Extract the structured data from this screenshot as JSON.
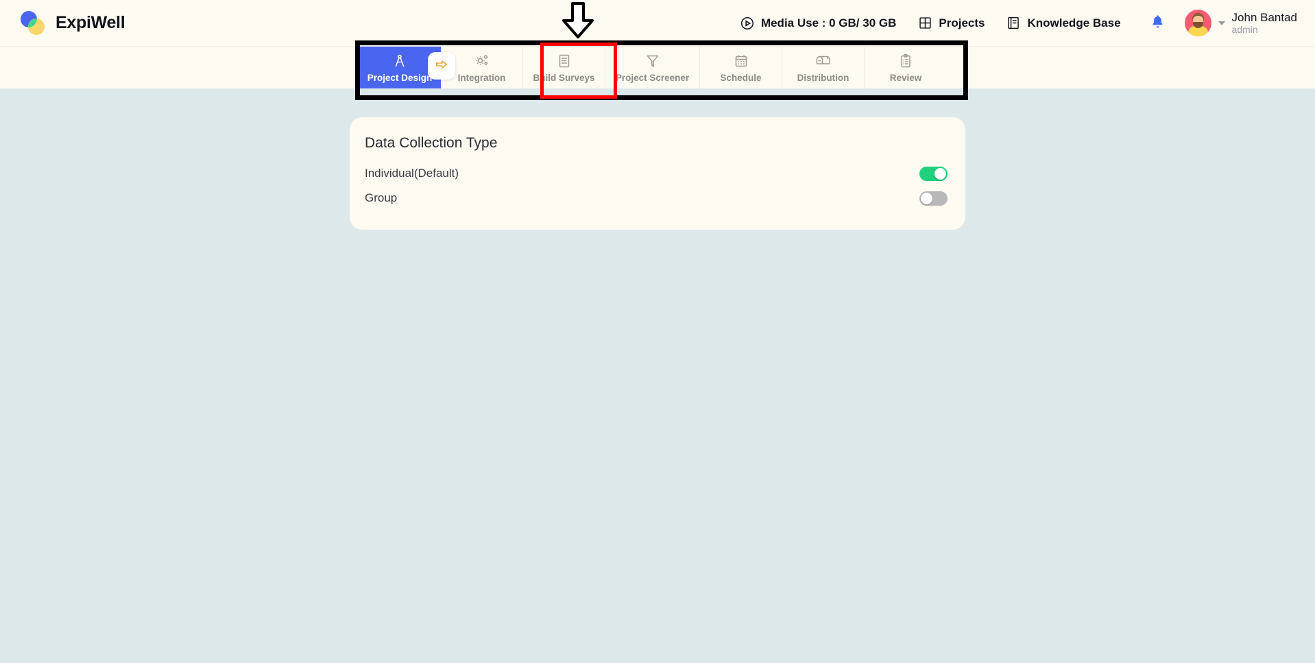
{
  "brand": {
    "name": "ExpiWell",
    "logo_icon": "expiwell-circles-logo",
    "colors": {
      "blue": "#4a66f0",
      "yellow": "#fbd76b",
      "green": "#3ed694"
    }
  },
  "header": {
    "media_use": {
      "icon": "play-circle-icon",
      "label": "Media Use : 0 GB/ 30 GB"
    },
    "projects": {
      "icon": "grid-icon",
      "label": "Projects"
    },
    "knowledge_base": {
      "icon": "book-icon",
      "label": "Knowledge Base"
    },
    "notifications": {
      "icon": "bell-icon",
      "color": "#3d6bff"
    },
    "user": {
      "avatar": "user-avatar",
      "name": "John Bantad",
      "role": "admin",
      "caret": "chevron-down-icon"
    }
  },
  "nav": {
    "active_tab": "Project Design",
    "highlighted_tab": "Build Surveys",
    "tabs": [
      {
        "label": "Project Design",
        "icon": "compass-icon",
        "active": true
      },
      {
        "label": "Integration",
        "icon": "gears-icon",
        "active": false
      },
      {
        "label": "Build Surveys",
        "icon": "document-lines-icon",
        "active": false
      },
      {
        "label": "Project Screener",
        "icon": "funnel-icon",
        "active": false
      },
      {
        "label": "Schedule",
        "icon": "calendar-icon",
        "active": false
      },
      {
        "label": "Distribution",
        "icon": "mailbox-icon",
        "active": false
      },
      {
        "label": "Review",
        "icon": "clipboard-icon",
        "active": false
      }
    ],
    "next_button": {
      "icon": "arrow-right-icon"
    }
  },
  "annotations": {
    "pointer_arrow": "down-arrow-annotation",
    "red_highlight_color": "#ff0000",
    "black_outline_color": "#000000"
  },
  "card": {
    "title": "Data Collection Type",
    "options": [
      {
        "label": "Individual(Default)",
        "state": "on"
      },
      {
        "label": "Group",
        "state": "off"
      }
    ]
  },
  "colors": {
    "page_background": "#dde8ea",
    "surface": "#fdfaf2",
    "accent_blue": "#4a66f0",
    "toggle_on": "#1fd07c",
    "toggle_off": "#b8b8b8"
  }
}
